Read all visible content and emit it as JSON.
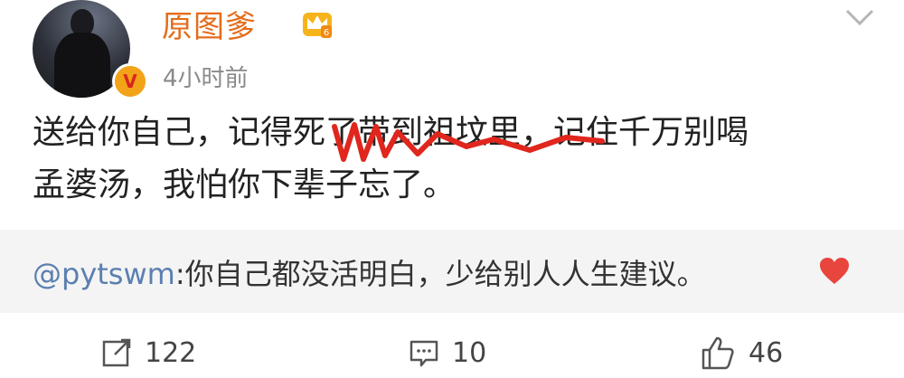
{
  "post": {
    "username": "原图爹",
    "timestamp": "4小时前",
    "verified_badge": "V",
    "body_line1": "送给你自己，记得死了带到祖坟里，记住千万别喝",
    "body_line2": "孟婆汤，我怕你下辈子忘了。"
  },
  "comment": {
    "mention": "@pytswm",
    "text": ":你自己都没活明白，少给别人人生建议。"
  },
  "actions": {
    "repost_count": "122",
    "comment_count": "10",
    "like_count": "46"
  },
  "colors": {
    "username": "#e46c1a",
    "mention": "#5b7fb0",
    "scribble": "#e0261d",
    "heart": "#e8453c"
  },
  "icons": [
    "crown-badge-icon",
    "chevron-down-icon",
    "heart-icon",
    "repost-icon",
    "comment-icon",
    "like-icon"
  ]
}
